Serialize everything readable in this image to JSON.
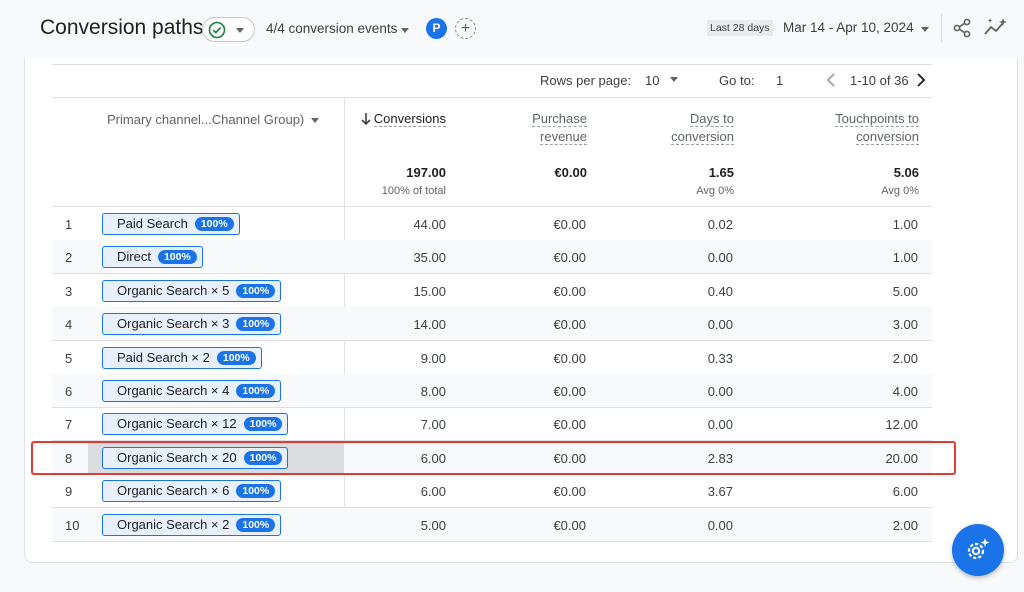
{
  "header": {
    "title": "Conversion paths",
    "events_label": "4/4 conversion events",
    "avatar_letter": "P",
    "add_comparison": "+",
    "range_label": "Last 28 days",
    "range_dates": "Mar 14 - Apr 10, 2024"
  },
  "pager": {
    "rows_per_page_label": "Rows per page:",
    "rows_per_page_value": "10",
    "goto_label": "Go to:",
    "goto_value": "1",
    "range_text": "1-10 of 36"
  },
  "table": {
    "dimension_header": "Primary channel...Channel Group)",
    "headers": {
      "conversions": "Conversions",
      "purchase_revenue_1": "Purchase",
      "purchase_revenue_2": "revenue",
      "days_1": "Days to",
      "days_2": "conversion",
      "touch_1": "Touchpoints to",
      "touch_2": "conversion"
    },
    "totals": {
      "conversions": "197.00",
      "conversions_sub": "100% of total",
      "revenue": "€0.00",
      "days": "1.65",
      "days_sub": "Avg 0%",
      "touch": "5.06",
      "touch_sub": "Avg 0%"
    },
    "rows": [
      {
        "num": "1",
        "path": "Paid Search",
        "pct": "100%",
        "conversions": "44.00",
        "revenue": "€0.00",
        "days": "0.02",
        "touch": "1.00"
      },
      {
        "num": "2",
        "path": "Direct",
        "pct": "100%",
        "conversions": "35.00",
        "revenue": "€0.00",
        "days": "0.00",
        "touch": "1.00"
      },
      {
        "num": "3",
        "path": "Organic Search × 5",
        "pct": "100%",
        "conversions": "15.00",
        "revenue": "€0.00",
        "days": "0.40",
        "touch": "5.00"
      },
      {
        "num": "4",
        "path": "Organic Search × 3",
        "pct": "100%",
        "conversions": "14.00",
        "revenue": "€0.00",
        "days": "0.00",
        "touch": "3.00"
      },
      {
        "num": "5",
        "path": "Paid Search × 2",
        "pct": "100%",
        "conversions": "9.00",
        "revenue": "€0.00",
        "days": "0.33",
        "touch": "2.00"
      },
      {
        "num": "6",
        "path": "Organic Search × 4",
        "pct": "100%",
        "conversions": "8.00",
        "revenue": "€0.00",
        "days": "0.00",
        "touch": "4.00"
      },
      {
        "num": "7",
        "path": "Organic Search × 12",
        "pct": "100%",
        "conversions": "7.00",
        "revenue": "€0.00",
        "days": "0.00",
        "touch": "12.00"
      },
      {
        "num": "8",
        "path": "Organic Search × 20",
        "pct": "100%",
        "conversions": "6.00",
        "revenue": "€0.00",
        "days": "2.83",
        "touch": "20.00"
      },
      {
        "num": "9",
        "path": "Organic Search × 6",
        "pct": "100%",
        "conversions": "6.00",
        "revenue": "€0.00",
        "days": "3.67",
        "touch": "6.00"
      },
      {
        "num": "10",
        "path": "Organic Search × 2",
        "pct": "100%",
        "conversions": "5.00",
        "revenue": "€0.00",
        "days": "0.00",
        "touch": "2.00"
      }
    ]
  },
  "colors": {
    "accent": "#1a73e8",
    "highlight": "#e53935",
    "success": "#188038"
  },
  "icons": [
    "check-circle-icon",
    "share-icon",
    "insights-icon",
    "chevron-left-icon",
    "chevron-right-icon",
    "sort-down-arrow-icon",
    "gear-sparkle-icon"
  ]
}
